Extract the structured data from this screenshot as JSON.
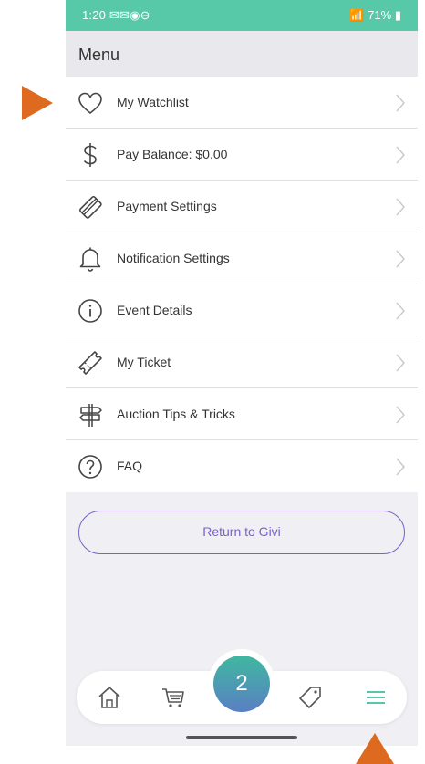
{
  "status_bar": {
    "time": "1:20",
    "left_icons": "✉✉◉⊖",
    "right_text": "71%"
  },
  "menu": {
    "title": "Menu"
  },
  "items": [
    {
      "label": "My Watchlist",
      "icon": "heart-icon"
    },
    {
      "label": "Pay Balance: $0.00",
      "icon": "dollar-icon"
    },
    {
      "label": "Payment Settings",
      "icon": "card-icon"
    },
    {
      "label": "Notification Settings",
      "icon": "bell-icon"
    },
    {
      "label": "Event Details",
      "icon": "info-icon"
    },
    {
      "label": "My Ticket",
      "icon": "ticket-icon"
    },
    {
      "label": "Auction Tips & Tricks",
      "icon": "signpost-icon"
    },
    {
      "label": "FAQ",
      "icon": "question-icon"
    }
  ],
  "return_button": {
    "label": "Return to Givi"
  },
  "bottom_nav": {
    "cart_count": "2",
    "items": [
      "home-icon",
      "cart-icon",
      "tag-icon",
      "menu-icon"
    ],
    "active": "menu-icon"
  },
  "colors": {
    "status_bar": "#57c9a8",
    "accent": "#7b61c9",
    "annotation": "#dd6a1f",
    "nav_active": "#3fbfa0"
  }
}
